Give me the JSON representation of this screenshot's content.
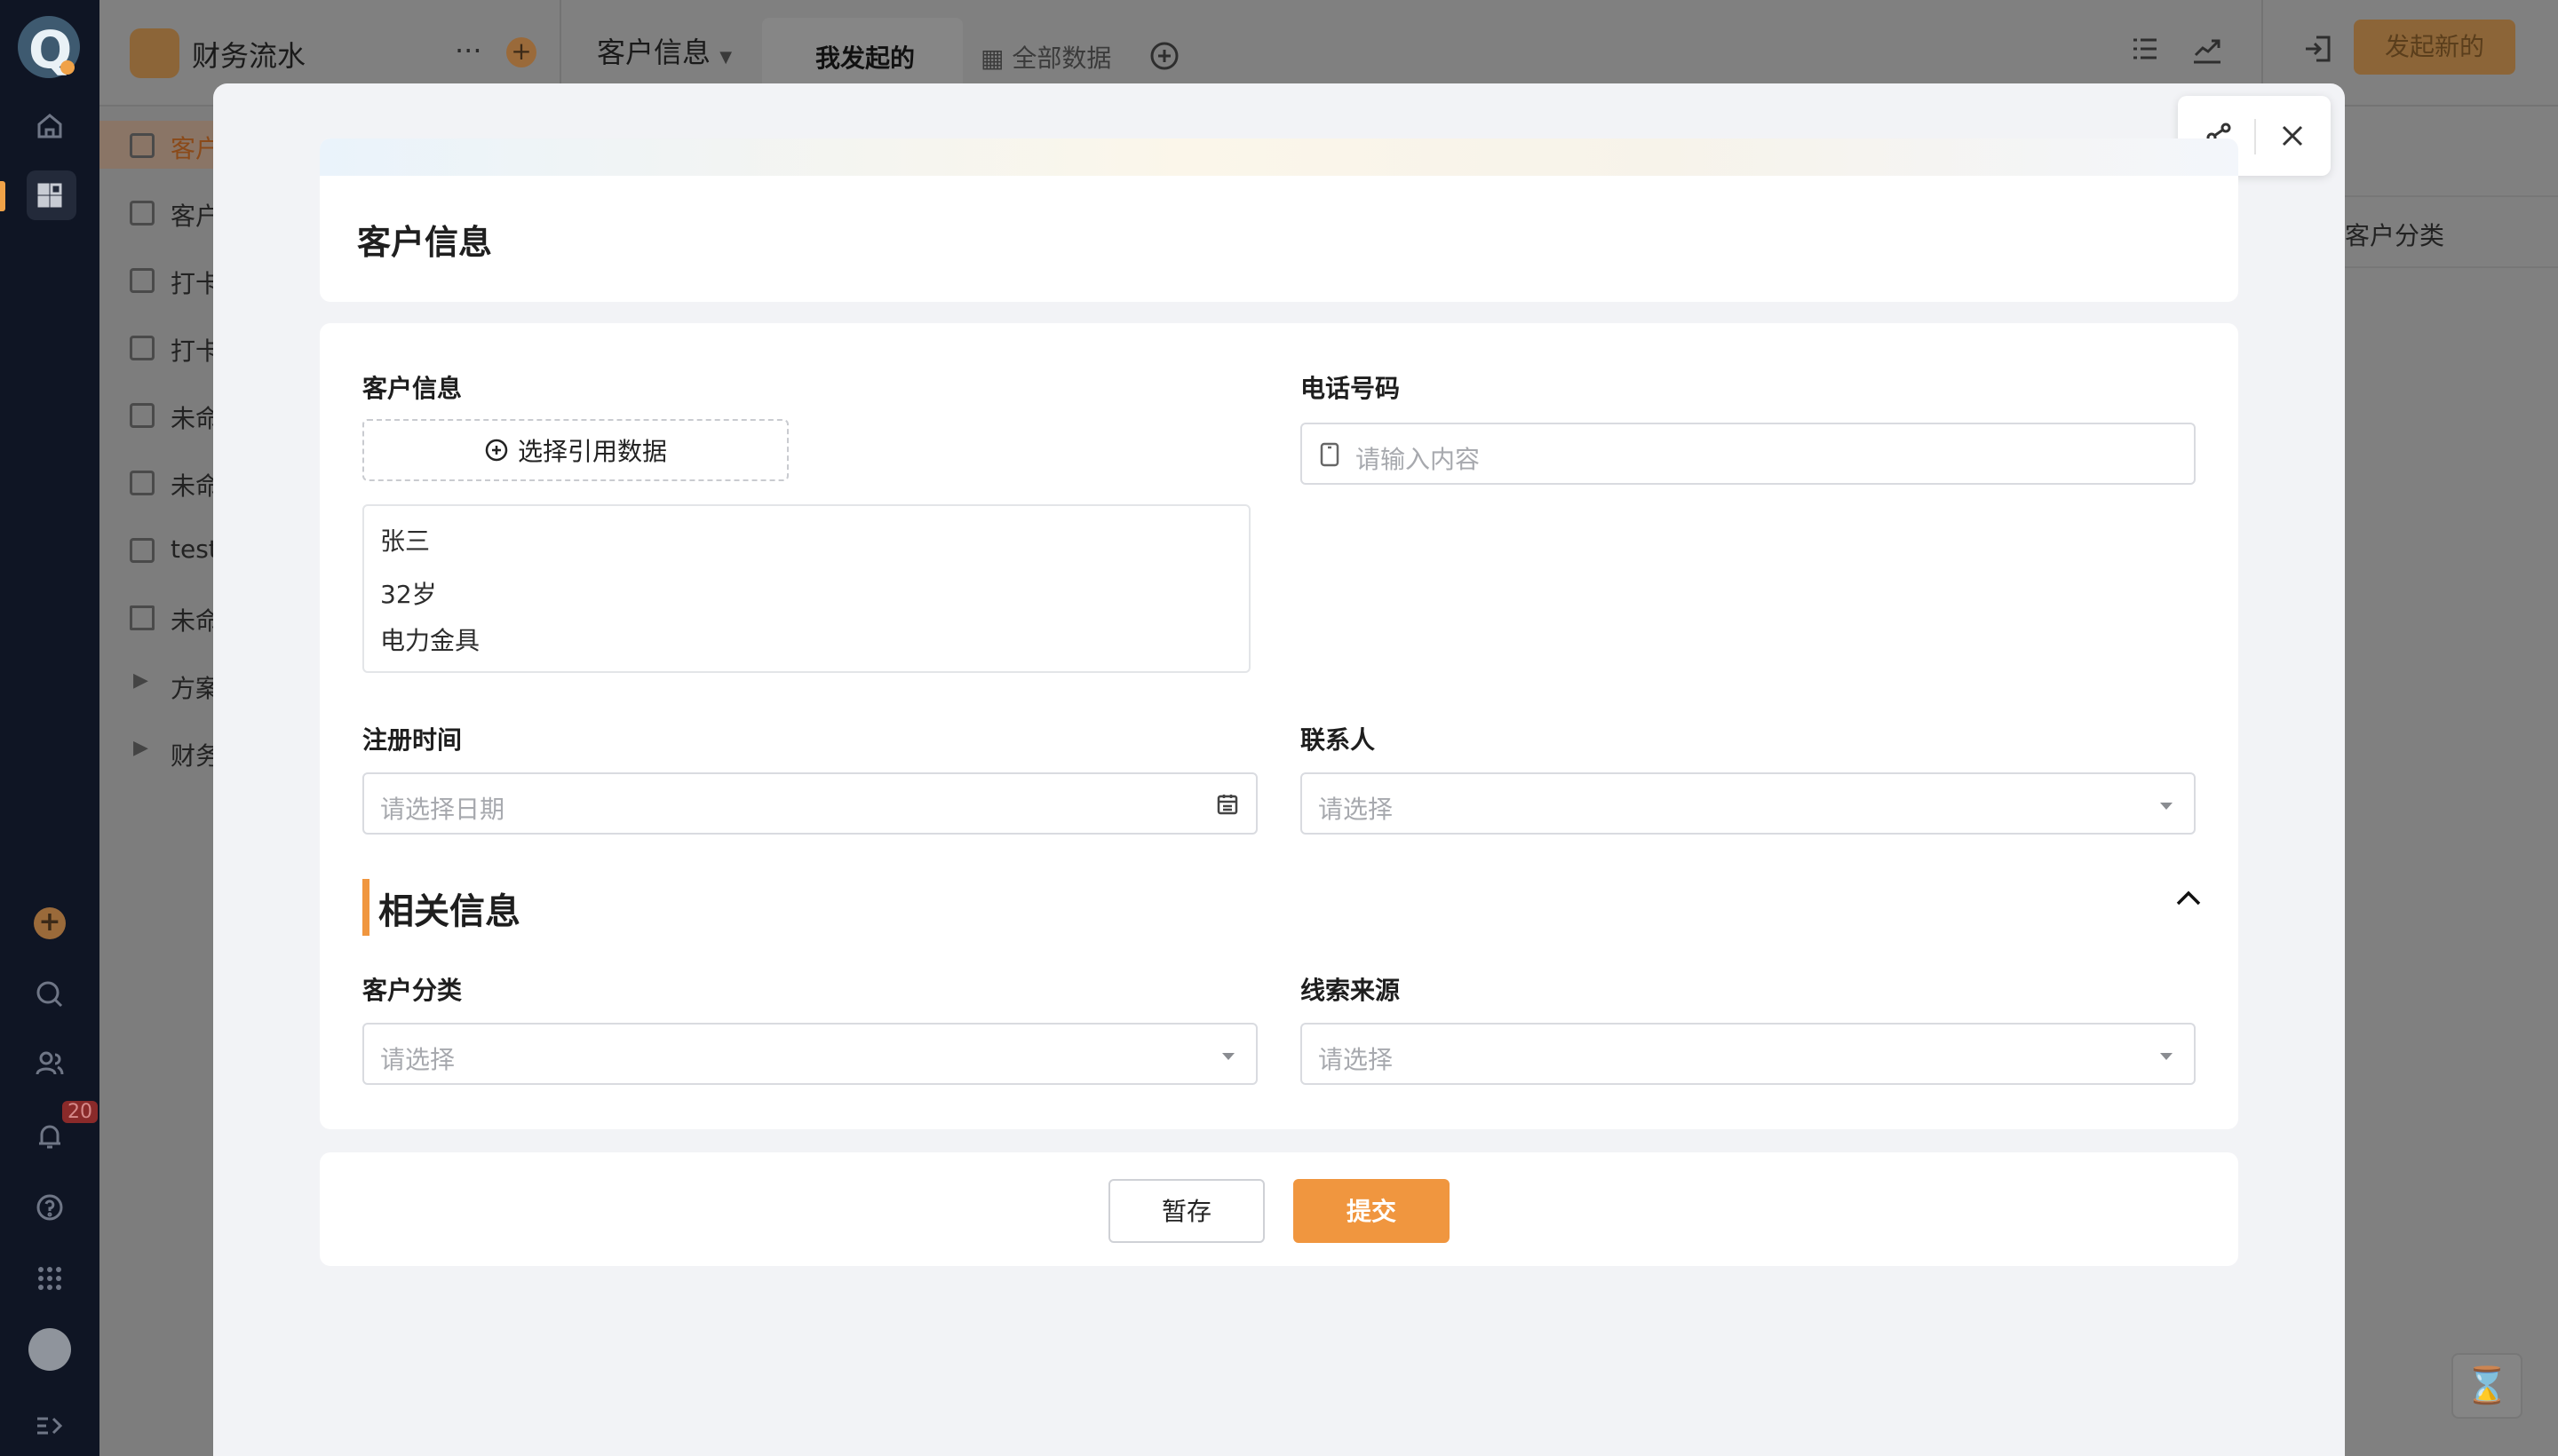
{
  "app": {
    "title": "财务流水",
    "more": "···",
    "add": "+",
    "launch_button": "发起新的"
  },
  "topbar": {
    "main_tab": "客户信息",
    "view_tab": "我发起的",
    "all_data_tab": "全部数据"
  },
  "rail": {
    "notification_count": "20"
  },
  "sidebar": {
    "items": [
      {
        "label": "客户",
        "icon": "form-icon"
      },
      {
        "label": "客户",
        "icon": "form-icon"
      },
      {
        "label": "打卡",
        "icon": "form-icon"
      },
      {
        "label": "打卡",
        "icon": "form-icon"
      },
      {
        "label": "未命",
        "icon": "form-icon"
      },
      {
        "label": "未命",
        "icon": "form-icon"
      },
      {
        "label": "test",
        "icon": "form-icon"
      },
      {
        "label": "未命",
        "icon": "dashboard-icon"
      },
      {
        "label": "方案",
        "icon": "caret-right-icon"
      },
      {
        "label": "财务",
        "icon": "caret-right-icon"
      }
    ]
  },
  "background": {
    "column_header": "客户分类"
  },
  "modal": {
    "title": "客户信息",
    "fields": {
      "customer_info": {
        "label": "客户信息",
        "select_button": "选择引用数据",
        "record": {
          "name": "张三",
          "age": "32岁",
          "company": "电力金具"
        }
      },
      "phone": {
        "label": "电话号码",
        "placeholder": "请输入内容"
      },
      "register_time": {
        "label": "注册时间",
        "placeholder": "请选择日期"
      },
      "contact": {
        "label": "联系人",
        "placeholder": "请选择"
      }
    },
    "section": {
      "title": "相关信息",
      "fields": {
        "customer_category": {
          "label": "客户分类",
          "placeholder": "请选择"
        },
        "lead_source": {
          "label": "线索来源",
          "placeholder": "请选择"
        }
      }
    },
    "actions": {
      "save": "暂存",
      "submit": "提交"
    }
  },
  "colors": {
    "accent": "#f0963f",
    "rail_bg": "#0f1524"
  }
}
